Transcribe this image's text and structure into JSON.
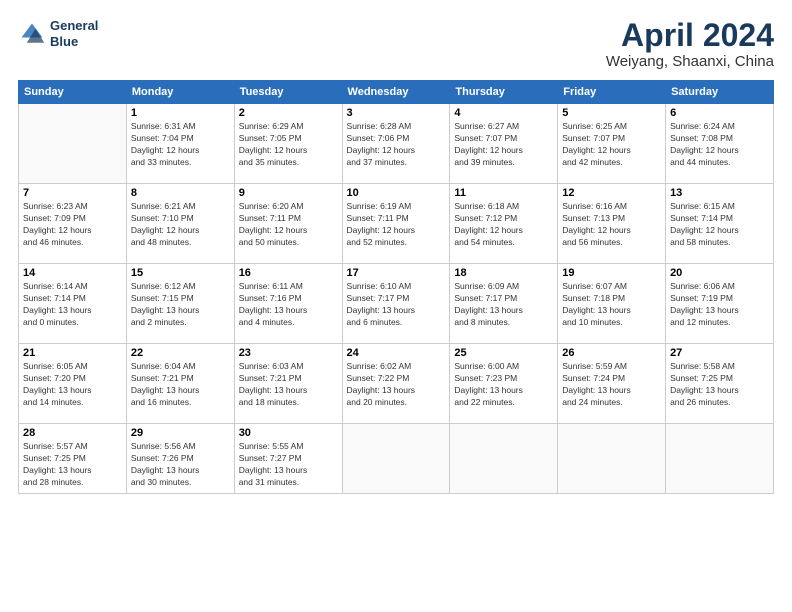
{
  "logo": {
    "line1": "General",
    "line2": "Blue"
  },
  "title": "April 2024",
  "subtitle": "Weiyang, Shaanxi, China",
  "weekdays": [
    "Sunday",
    "Monday",
    "Tuesday",
    "Wednesday",
    "Thursday",
    "Friday",
    "Saturday"
  ],
  "weeks": [
    [
      {
        "day": "",
        "info": ""
      },
      {
        "day": "1",
        "info": "Sunrise: 6:31 AM\nSunset: 7:04 PM\nDaylight: 12 hours\nand 33 minutes."
      },
      {
        "day": "2",
        "info": "Sunrise: 6:29 AM\nSunset: 7:05 PM\nDaylight: 12 hours\nand 35 minutes."
      },
      {
        "day": "3",
        "info": "Sunrise: 6:28 AM\nSunset: 7:06 PM\nDaylight: 12 hours\nand 37 minutes."
      },
      {
        "day": "4",
        "info": "Sunrise: 6:27 AM\nSunset: 7:07 PM\nDaylight: 12 hours\nand 39 minutes."
      },
      {
        "day": "5",
        "info": "Sunrise: 6:25 AM\nSunset: 7:07 PM\nDaylight: 12 hours\nand 42 minutes."
      },
      {
        "day": "6",
        "info": "Sunrise: 6:24 AM\nSunset: 7:08 PM\nDaylight: 12 hours\nand 44 minutes."
      }
    ],
    [
      {
        "day": "7",
        "info": "Sunrise: 6:23 AM\nSunset: 7:09 PM\nDaylight: 12 hours\nand 46 minutes."
      },
      {
        "day": "8",
        "info": "Sunrise: 6:21 AM\nSunset: 7:10 PM\nDaylight: 12 hours\nand 48 minutes."
      },
      {
        "day": "9",
        "info": "Sunrise: 6:20 AM\nSunset: 7:11 PM\nDaylight: 12 hours\nand 50 minutes."
      },
      {
        "day": "10",
        "info": "Sunrise: 6:19 AM\nSunset: 7:11 PM\nDaylight: 12 hours\nand 52 minutes."
      },
      {
        "day": "11",
        "info": "Sunrise: 6:18 AM\nSunset: 7:12 PM\nDaylight: 12 hours\nand 54 minutes."
      },
      {
        "day": "12",
        "info": "Sunrise: 6:16 AM\nSunset: 7:13 PM\nDaylight: 12 hours\nand 56 minutes."
      },
      {
        "day": "13",
        "info": "Sunrise: 6:15 AM\nSunset: 7:14 PM\nDaylight: 12 hours\nand 58 minutes."
      }
    ],
    [
      {
        "day": "14",
        "info": "Sunrise: 6:14 AM\nSunset: 7:14 PM\nDaylight: 13 hours\nand 0 minutes."
      },
      {
        "day": "15",
        "info": "Sunrise: 6:12 AM\nSunset: 7:15 PM\nDaylight: 13 hours\nand 2 minutes."
      },
      {
        "day": "16",
        "info": "Sunrise: 6:11 AM\nSunset: 7:16 PM\nDaylight: 13 hours\nand 4 minutes."
      },
      {
        "day": "17",
        "info": "Sunrise: 6:10 AM\nSunset: 7:17 PM\nDaylight: 13 hours\nand 6 minutes."
      },
      {
        "day": "18",
        "info": "Sunrise: 6:09 AM\nSunset: 7:17 PM\nDaylight: 13 hours\nand 8 minutes."
      },
      {
        "day": "19",
        "info": "Sunrise: 6:07 AM\nSunset: 7:18 PM\nDaylight: 13 hours\nand 10 minutes."
      },
      {
        "day": "20",
        "info": "Sunrise: 6:06 AM\nSunset: 7:19 PM\nDaylight: 13 hours\nand 12 minutes."
      }
    ],
    [
      {
        "day": "21",
        "info": "Sunrise: 6:05 AM\nSunset: 7:20 PM\nDaylight: 13 hours\nand 14 minutes."
      },
      {
        "day": "22",
        "info": "Sunrise: 6:04 AM\nSunset: 7:21 PM\nDaylight: 13 hours\nand 16 minutes."
      },
      {
        "day": "23",
        "info": "Sunrise: 6:03 AM\nSunset: 7:21 PM\nDaylight: 13 hours\nand 18 minutes."
      },
      {
        "day": "24",
        "info": "Sunrise: 6:02 AM\nSunset: 7:22 PM\nDaylight: 13 hours\nand 20 minutes."
      },
      {
        "day": "25",
        "info": "Sunrise: 6:00 AM\nSunset: 7:23 PM\nDaylight: 13 hours\nand 22 minutes."
      },
      {
        "day": "26",
        "info": "Sunrise: 5:59 AM\nSunset: 7:24 PM\nDaylight: 13 hours\nand 24 minutes."
      },
      {
        "day": "27",
        "info": "Sunrise: 5:58 AM\nSunset: 7:25 PM\nDaylight: 13 hours\nand 26 minutes."
      }
    ],
    [
      {
        "day": "28",
        "info": "Sunrise: 5:57 AM\nSunset: 7:25 PM\nDaylight: 13 hours\nand 28 minutes."
      },
      {
        "day": "29",
        "info": "Sunrise: 5:56 AM\nSunset: 7:26 PM\nDaylight: 13 hours\nand 30 minutes."
      },
      {
        "day": "30",
        "info": "Sunrise: 5:55 AM\nSunset: 7:27 PM\nDaylight: 13 hours\nand 31 minutes."
      },
      {
        "day": "",
        "info": ""
      },
      {
        "day": "",
        "info": ""
      },
      {
        "day": "",
        "info": ""
      },
      {
        "day": "",
        "info": ""
      }
    ]
  ]
}
